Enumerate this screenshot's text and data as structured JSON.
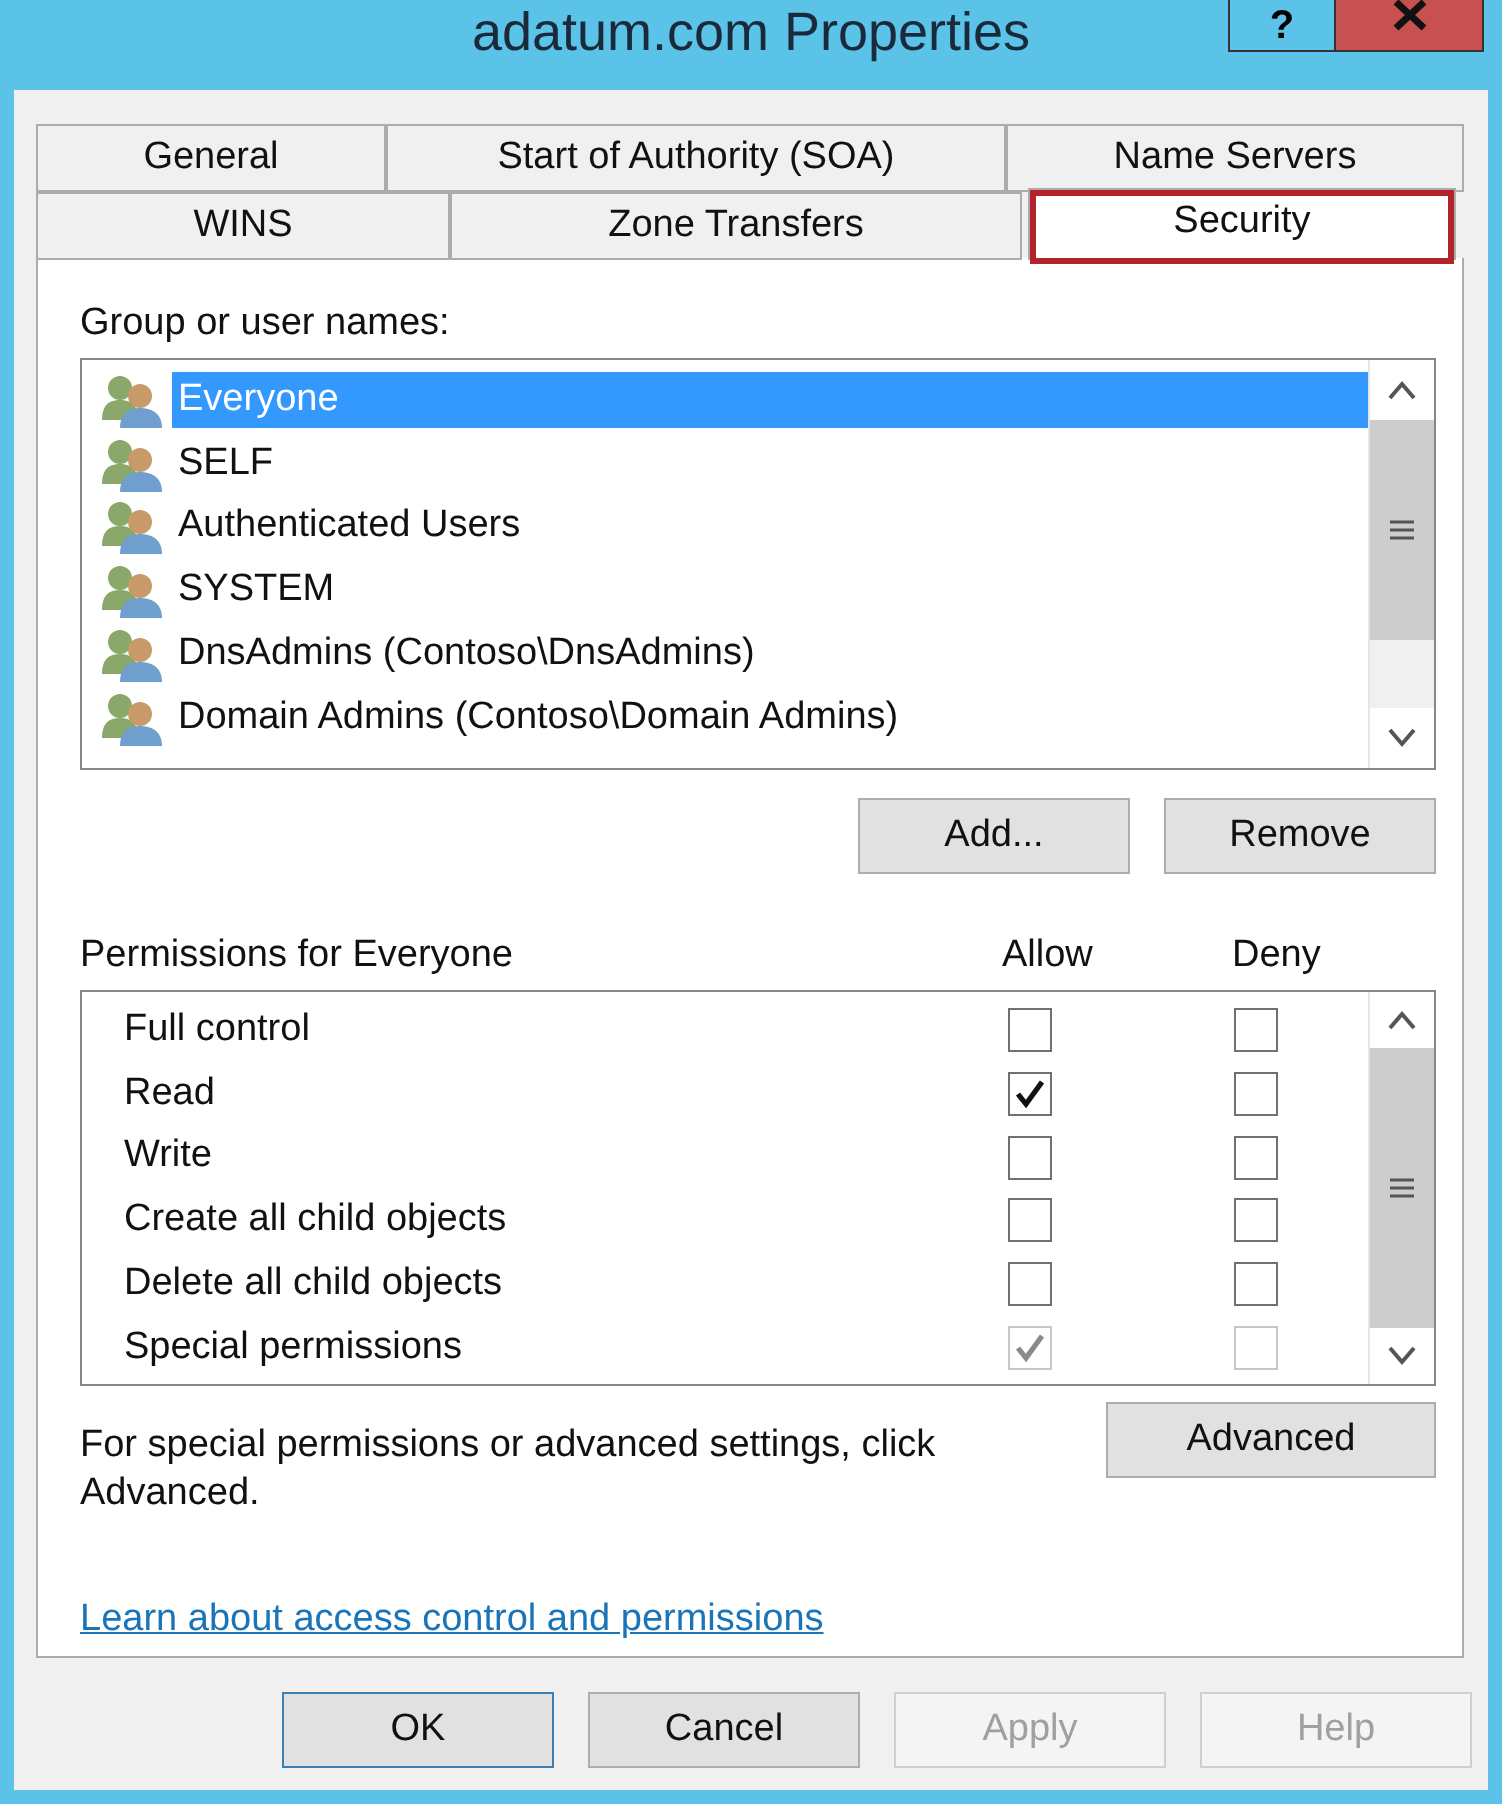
{
  "window": {
    "title": "adatum.com Properties",
    "help_button": "?"
  },
  "tabs": [
    [
      {
        "label": "General",
        "selected": false,
        "highlighted": false
      },
      {
        "label": "Start of Authority (SOA)",
        "selected": false,
        "highlighted": false
      },
      {
        "label": "Name Servers",
        "selected": false,
        "highlighted": false
      }
    ],
    [
      {
        "label": "WINS",
        "selected": false,
        "highlighted": false
      },
      {
        "label": "Zone Transfers",
        "selected": false,
        "highlighted": false
      },
      {
        "label": "Security",
        "selected": true,
        "highlighted": true
      }
    ]
  ],
  "groups": {
    "label": "Group or user names:",
    "items": [
      {
        "name": "Everyone",
        "selected": true
      },
      {
        "name": "SELF",
        "selected": false
      },
      {
        "name": "Authenticated Users",
        "selected": false
      },
      {
        "name": "SYSTEM",
        "selected": false
      },
      {
        "name": "DnsAdmins (Contoso\\DnsAdmins)",
        "selected": false
      },
      {
        "name": "Domain Admins (Contoso\\Domain Admins)",
        "selected": false
      }
    ],
    "buttons": [
      "Add...",
      "Remove"
    ]
  },
  "permissions": {
    "label": "Permissions for Everyone",
    "columns": [
      "Allow",
      "Deny"
    ],
    "rows": [
      {
        "name": "Full control",
        "allow": false,
        "deny": false,
        "disabled": false
      },
      {
        "name": "Read",
        "allow": true,
        "deny": false,
        "disabled": false
      },
      {
        "name": "Write",
        "allow": false,
        "deny": false,
        "disabled": false
      },
      {
        "name": "Create all child objects",
        "allow": false,
        "deny": false,
        "disabled": false
      },
      {
        "name": "Delete all child objects",
        "allow": false,
        "deny": false,
        "disabled": false
      },
      {
        "name": "Special permissions",
        "allow": true,
        "deny": false,
        "disabled": true
      }
    ]
  },
  "advanced": {
    "note": "For special permissions or advanced settings, click Advanced.",
    "button": "Advanced"
  },
  "link": "Learn about access control and permissions",
  "footer_buttons": [
    {
      "label": "OK",
      "disabled": false,
      "default": true
    },
    {
      "label": "Cancel",
      "disabled": false,
      "default": false
    },
    {
      "label": "Apply",
      "disabled": true,
      "default": false
    },
    {
      "label": "Help",
      "disabled": true,
      "default": false
    }
  ]
}
